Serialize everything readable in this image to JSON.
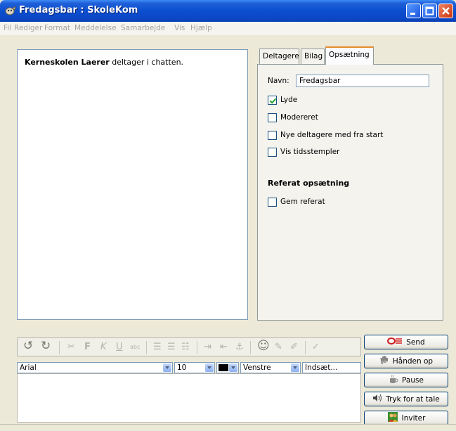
{
  "window": {
    "title": "Fredagsbar : SkoleKom"
  },
  "menu": {
    "items": [
      "Fil",
      "Rediger",
      "Format",
      "Meddelelse",
      "Samarbejde",
      "Vis",
      "Hjælp"
    ]
  },
  "chat": {
    "sender": "Kerneskolen Laerer",
    "message": " deltager i chatten."
  },
  "tabs": {
    "items": [
      "Deltagere",
      "Bilag",
      "Opsætning"
    ],
    "active": "Opsætning"
  },
  "settings": {
    "name_label": "Navn:",
    "name_value": "Fredagsbar",
    "options": [
      {
        "label": "Lyde",
        "checked": true
      },
      {
        "label": "Modereret",
        "checked": false
      },
      {
        "label": "Nye deltagere med fra start",
        "checked": false
      },
      {
        "label": "Vis tidsstempler",
        "checked": false
      }
    ],
    "referat_heading": "Referat opsætning",
    "referat_option": {
      "label": "Gem referat",
      "checked": false
    }
  },
  "editor": {
    "font": "Arial",
    "size": "10",
    "align": "Venstre",
    "insert": "Indsæt...",
    "color": "#000000",
    "toolbar_icons": [
      "undo-icon",
      "redo-icon",
      "cut-icon",
      "bold-icon",
      "italic-icon",
      "underline-icon",
      "abc-icon",
      "align-left-icon",
      "numbered-list-icon",
      "bullet-list-icon",
      "indent-icon",
      "outdent-icon",
      "link-icon",
      "emoticon-icon",
      "pen-icon",
      "brush-icon",
      "spellcheck-icon"
    ]
  },
  "actions": {
    "send": "Send",
    "hand_up": "Hånden op",
    "pause": "Pause",
    "talk": "Tryk for at tale",
    "invite": "Inviter"
  }
}
